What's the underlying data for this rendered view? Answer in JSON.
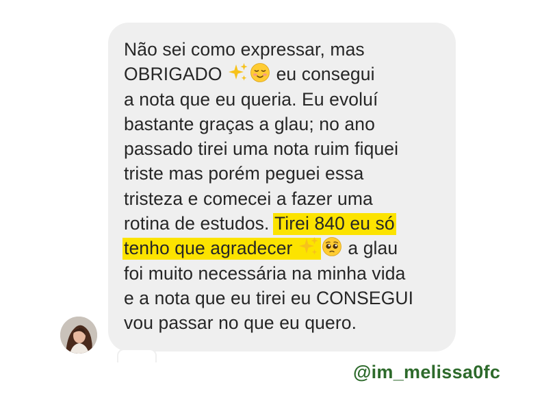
{
  "message": {
    "lines": [
      "Não sei como expressar, mas",
      "OBRIGADO",
      "eu consegui",
      "a nota que eu queria. Eu evoluí",
      "bastante graças a glau; no ano",
      "passado tirei uma nota ruim fiquei",
      "triste mas porém peguei essa",
      "tristeza e comecei a fazer uma",
      "rotina de estudos.",
      "Tirei 840 eu só",
      "tenho que agradecer",
      "a glau",
      "foi muito necessária na minha vida",
      "e a nota que eu tirei eu CONSEGUI",
      "vou passar no que eu quero."
    ],
    "highlight_color": "#fce300",
    "bubble_color": "#efefef",
    "text_color": "#262626"
  },
  "emojis": {
    "sparkles": "sparkles-icon",
    "smiling_face": "relieved-face-icon",
    "pleading_face": "pleading-face-icon"
  },
  "watermark": {
    "handle": "@im_melissa0fc",
    "color": "#2d6a2b"
  }
}
